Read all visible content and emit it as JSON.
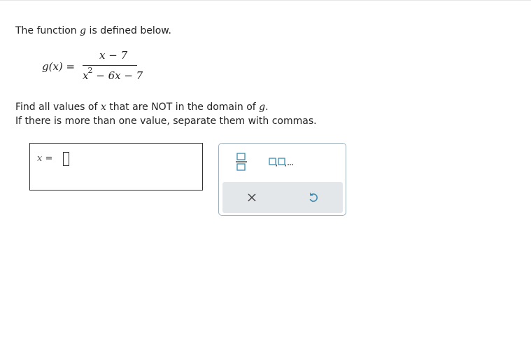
{
  "problem": {
    "intro_prefix": "The function ",
    "func_name": "g",
    "intro_suffix": " is defined below.",
    "formula": {
      "lhs": "g(x) =",
      "numerator": "x − 7",
      "den_x": "x",
      "den_exp": "2",
      "den_rest": " − 6x − 7"
    },
    "instruction_line1_a": "Find all values of ",
    "instruction_var": "x",
    "instruction_line1_b": " that are NOT in the domain of ",
    "instruction_func": "g",
    "instruction_line1_end": ".",
    "instruction_line2": "If there is more than one value, separate them with commas."
  },
  "answer": {
    "label_var": "x",
    "label_eq": " = ",
    "value": ""
  },
  "palette": {
    "buttons": [
      {
        "name": "fraction",
        "icon": "fraction-icon"
      },
      {
        "name": "sequence",
        "icon": "comma-sequence-icon"
      },
      {
        "name": "clear",
        "icon": "close-icon"
      },
      {
        "name": "undo",
        "icon": "undo-icon"
      }
    ],
    "colors": {
      "border": "#9fb0bd",
      "bottom_bg": "#e3e7ea",
      "icon": "#3b8bb2"
    }
  }
}
